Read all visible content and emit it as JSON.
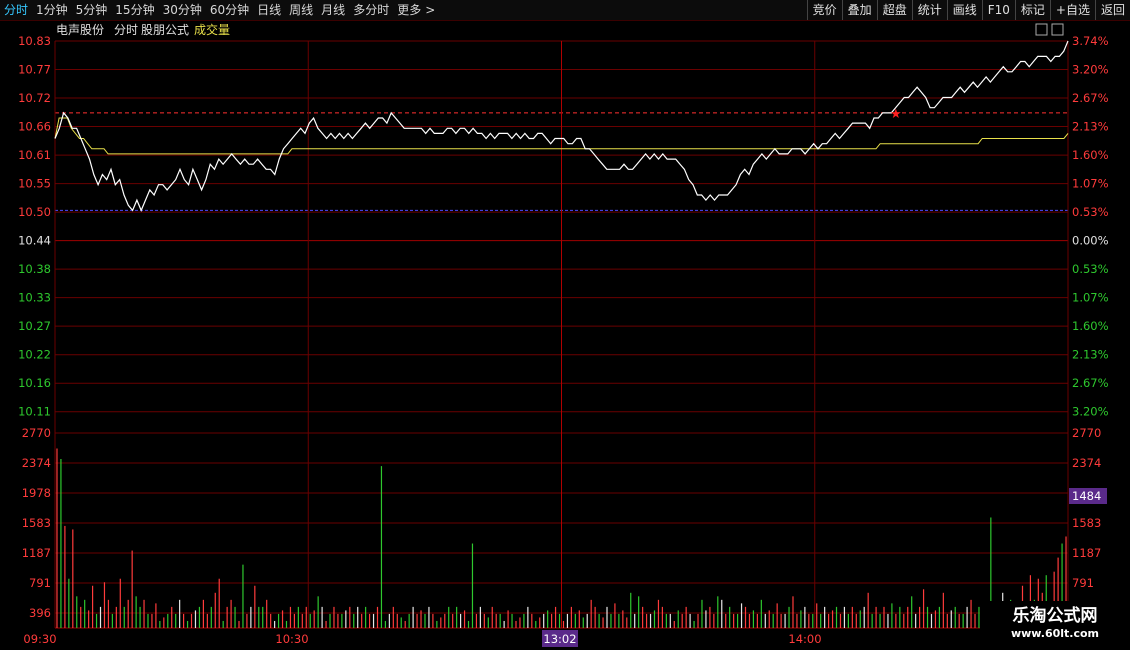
{
  "toolbar": {
    "left_items": [
      {
        "label": "分时",
        "active": true
      },
      {
        "label": "1分钟",
        "active": false
      },
      {
        "label": "5分钟",
        "active": false
      },
      {
        "label": "15分钟",
        "active": false
      },
      {
        "label": "30分钟",
        "active": false
      },
      {
        "label": "60分钟",
        "active": false
      },
      {
        "label": "日线",
        "active": false
      },
      {
        "label": "周线",
        "active": false
      },
      {
        "label": "月线",
        "active": false
      },
      {
        "label": "多分时",
        "active": false
      },
      {
        "label": "更多",
        "active": false
      }
    ],
    "more_icon": "chevron-right-icon",
    "right_items": [
      "竞价",
      "叠加",
      "超盘",
      "统计",
      "画线",
      "F10",
      "标记",
      "+自选",
      "返回"
    ]
  },
  "header": {
    "stock_name": "电声股份",
    "view": "分时",
    "formula": "股朋公式",
    "indicator": "成交量"
  },
  "watermark": {
    "line1": "乐淘公式网",
    "line2": "www.60lt.com"
  },
  "colors": {
    "up": "#ff3b3b",
    "down": "#2ec82e",
    "price": "#ffffff",
    "avg": "#e8e04a",
    "grid": "#6a0000"
  },
  "chart_data": [
    {
      "type": "line",
      "title": "",
      "x_ticks": [
        "09:30",
        "10:30",
        "13:02",
        "14:00"
      ],
      "y_left_ticks": [
        "10.83",
        "10.77",
        "10.72",
        "10.66",
        "10.61",
        "10.55",
        "10.50",
        "10.44",
        "10.38",
        "10.33",
        "10.27",
        "10.22",
        "10.16",
        "10.11"
      ],
      "y_right_ticks": [
        "3.74%",
        "3.20%",
        "2.67%",
        "2.13%",
        "1.60%",
        "1.07%",
        "0.53%",
        "0.00%",
        "0.53%",
        "1.07%",
        "1.60%",
        "2.13%",
        "2.67%",
        "3.20%"
      ],
      "ylim": [
        10.08,
        10.83
      ],
      "prev_close": 10.44,
      "reference_line": 10.5,
      "day_high": 10.69,
      "series": [
        {
          "values": [
            10.64,
            10.66,
            10.69,
            10.68,
            10.66,
            10.66,
            10.64,
            10.62,
            10.6,
            10.57,
            10.55,
            10.57,
            10.56,
            10.58,
            10.55,
            10.56,
            10.53,
            10.51,
            10.5,
            10.52,
            10.5,
            10.52,
            10.54,
            10.53,
            10.55,
            10.55,
            10.54,
            10.55,
            10.56,
            10.58,
            10.56,
            10.55,
            10.58,
            10.56,
            10.54,
            10.56,
            10.59,
            10.58,
            10.6,
            10.59,
            10.6,
            10.61,
            10.6,
            10.59,
            10.6,
            10.59,
            10.59,
            10.6,
            10.59,
            10.58,
            10.58,
            10.57,
            10.6,
            10.62,
            10.63,
            10.64,
            10.65,
            10.66,
            10.65,
            10.67,
            10.68,
            10.66,
            10.65,
            10.64,
            10.65,
            10.64,
            10.65,
            10.64,
            10.65,
            10.64,
            10.65,
            10.66,
            10.67,
            10.66,
            10.67,
            10.68,
            10.68,
            10.67,
            10.69,
            10.68,
            10.67,
            10.66,
            10.66,
            10.66,
            10.66,
            10.66,
            10.65,
            10.66,
            10.65,
            10.65,
            10.65,
            10.66,
            10.66,
            10.65,
            10.66,
            10.66,
            10.65,
            10.66,
            10.65,
            10.65,
            10.64,
            10.65,
            10.64,
            10.65,
            10.65,
            10.65,
            10.64,
            10.65,
            10.64,
            10.65,
            10.64,
            10.64,
            10.65,
            10.65,
            10.64,
            10.63,
            10.64,
            10.64,
            10.64,
            10.63,
            10.63,
            10.64,
            10.64,
            10.62,
            10.62,
            10.61,
            10.6,
            10.59,
            10.58,
            10.58,
            10.58,
            10.58,
            10.59,
            10.58,
            10.58,
            10.59,
            10.6,
            10.61,
            10.6,
            10.61,
            10.6,
            10.61,
            10.6,
            10.6,
            10.6,
            10.59,
            10.58,
            10.56,
            10.55,
            10.53,
            10.53,
            10.52,
            10.53,
            10.52,
            10.53,
            10.53,
            10.53,
            10.54,
            10.55,
            10.57,
            10.58,
            10.57,
            10.59,
            10.6,
            10.61,
            10.6,
            10.61,
            10.62,
            10.61,
            10.61,
            10.61,
            10.62,
            10.62,
            10.62,
            10.61,
            10.62,
            10.63,
            10.62,
            10.63,
            10.63,
            10.64,
            10.65,
            10.64,
            10.65,
            10.66,
            10.67,
            10.67,
            10.67,
            10.67,
            10.66,
            10.68,
            10.68,
            10.69,
            10.69,
            10.69,
            10.7,
            10.71,
            10.72,
            10.72,
            10.73,
            10.74,
            10.73,
            10.72,
            10.7,
            10.7,
            10.71,
            10.72,
            10.72,
            10.72,
            10.73,
            10.74,
            10.73,
            10.74,
            10.75,
            10.74,
            10.75,
            10.76,
            10.75,
            10.76,
            10.77,
            10.78,
            10.77,
            10.77,
            10.78,
            10.79,
            10.79,
            10.78,
            10.79,
            10.8,
            10.8,
            10.8,
            10.79,
            10.8,
            10.8,
            10.81,
            10.83
          ]
        },
        {
          "values": [
            10.64,
            10.68,
            10.68,
            10.68,
            10.66,
            10.65,
            10.64,
            10.64,
            10.63,
            10.62,
            10.62,
            10.62,
            10.62,
            10.61,
            10.61,
            10.61,
            10.61,
            10.61,
            10.61,
            10.61,
            10.61,
            10.61,
            10.61,
            10.61,
            10.61,
            10.61,
            10.61,
            10.61,
            10.61,
            10.61,
            10.61,
            10.61,
            10.61,
            10.61,
            10.61,
            10.61,
            10.61,
            10.61,
            10.61,
            10.61,
            10.61,
            10.61,
            10.61,
            10.61,
            10.61,
            10.61,
            10.61,
            10.61,
            10.61,
            10.61,
            10.61,
            10.61,
            10.61,
            10.61,
            10.61,
            10.61,
            10.61,
            10.61,
            10.62,
            10.62,
            10.62,
            10.62,
            10.62,
            10.62,
            10.62,
            10.62,
            10.62,
            10.62,
            10.62,
            10.62,
            10.62,
            10.62,
            10.62,
            10.62,
            10.62,
            10.62,
            10.62,
            10.62,
            10.62,
            10.62,
            10.62,
            10.62,
            10.62,
            10.62,
            10.62,
            10.62,
            10.62,
            10.62,
            10.62,
            10.62,
            10.62,
            10.62,
            10.62,
            10.62,
            10.62,
            10.62,
            10.62,
            10.62,
            10.62,
            10.62,
            10.62,
            10.62,
            10.62,
            10.62,
            10.62,
            10.62,
            10.62,
            10.62,
            10.62,
            10.62,
            10.62,
            10.62,
            10.62,
            10.62,
            10.62,
            10.62,
            10.62,
            10.62,
            10.62,
            10.62,
            10.62,
            10.62,
            10.62,
            10.62,
            10.62,
            10.62,
            10.62,
            10.62,
            10.62,
            10.62,
            10.62,
            10.62,
            10.62,
            10.62,
            10.62,
            10.62,
            10.62,
            10.62,
            10.62,
            10.62,
            10.62,
            10.62,
            10.62,
            10.62,
            10.62,
            10.62,
            10.62,
            10.62,
            10.62,
            10.62,
            10.62,
            10.62,
            10.62,
            10.62,
            10.62,
            10.62,
            10.62,
            10.62,
            10.62,
            10.62,
            10.62,
            10.62,
            10.62,
            10.62,
            10.62,
            10.62,
            10.62,
            10.62,
            10.62,
            10.62,
            10.62,
            10.62,
            10.62,
            10.62,
            10.62,
            10.62,
            10.62,
            10.62,
            10.62,
            10.62,
            10.62,
            10.62,
            10.62,
            10.62,
            10.62,
            10.62,
            10.62,
            10.62,
            10.62,
            10.62,
            10.62,
            10.62,
            10.62,
            10.62,
            10.62,
            10.62,
            10.62,
            10.62,
            10.62,
            10.62,
            10.62,
            10.62,
            10.63,
            10.63,
            10.63,
            10.63,
            10.63,
            10.63,
            10.63,
            10.63,
            10.63,
            10.63,
            10.63,
            10.63,
            10.63,
            10.63,
            10.63,
            10.63,
            10.63,
            10.63,
            10.63,
            10.63,
            10.63,
            10.63,
            10.63,
            10.63,
            10.63,
            10.64,
            10.64,
            10.64,
            10.64,
            10.64,
            10.64,
            10.64,
            10.64,
            10.64,
            10.64,
            10.64,
            10.64,
            10.64,
            10.64,
            10.64,
            10.64,
            10.64,
            10.64,
            10.64,
            10.64,
            10.64,
            10.65
          ]
        }
      ]
    },
    {
      "type": "bar",
      "title": "",
      "y_ticks": [
        "2770",
        "2374",
        "1978",
        "1583",
        "1187",
        "791",
        "396"
      ],
      "ylim": [
        0,
        2770
      ],
      "last_value_label": "1484",
      "values": [
        2550,
        2400,
        1450,
        700,
        1400,
        450,
        300,
        400,
        250,
        600,
        200,
        300,
        650,
        400,
        200,
        300,
        700,
        300,
        400,
        1100,
        450,
        300,
        400,
        200,
        200,
        350,
        100,
        150,
        200,
        300,
        200,
        400,
        200,
        100,
        200,
        250,
        300,
        400,
        200,
        300,
        500,
        700,
        100,
        300,
        400,
        300,
        100,
        900,
        200,
        300,
        600,
        300,
        300,
        400,
        200,
        100,
        200,
        250,
        100,
        300,
        200,
        300,
        200,
        300,
        200,
        250,
        450,
        300,
        100,
        200,
        300,
        200,
        200,
        250,
        300,
        200,
        300,
        200,
        300,
        200,
        200,
        300,
        2300,
        100,
        200,
        300,
        200,
        150,
        100,
        200,
        300,
        200,
        250,
        200,
        300,
        200,
        100,
        150,
        200,
        300,
        200,
        300,
        200,
        250,
        100,
        1200,
        200,
        300,
        200,
        150,
        300,
        200,
        200,
        100,
        250,
        200,
        100,
        150,
        200,
        300,
        200,
        100,
        150,
        200,
        250,
        200,
        300,
        200,
        100,
        200,
        300,
        200,
        250,
        150,
        200,
        400,
        300,
        200,
        150,
        300,
        200,
        350,
        200,
        250,
        150,
        500,
        200,
        450,
        300,
        200,
        200,
        250,
        400,
        300,
        200,
        200,
        100,
        250,
        200,
        300,
        200,
        100,
        200,
        400,
        250,
        300,
        200,
        450,
        400,
        200,
        300,
        200,
        200,
        350,
        300,
        200,
        250,
        200,
        400,
        200,
        250,
        200,
        350,
        200,
        200,
        300,
        450,
        200,
        250,
        300,
        200,
        200,
        350,
        200,
        300,
        200,
        250,
        300,
        200,
        300,
        200,
        300,
        200,
        250,
        300,
        500,
        200,
        300,
        200,
        300,
        200,
        350,
        200,
        300,
        200,
        300,
        450,
        200,
        300,
        550,
        300,
        200,
        250,
        300,
        500,
        200,
        250,
        300,
        200,
        200,
        300,
        400,
        200,
        300,
        250,
        200,
        1570,
        300,
        200,
        500,
        250,
        400,
        200,
        300,
        600,
        200,
        750,
        400,
        700,
        500,
        750,
        200,
        800,
        1000,
        1200,
        1300
      ],
      "colors_seq": "rgrgrgrgrrgwrrgrrgrrggrgrrgrgrgwrgrwgrrgrrgrrgrgrwrggrrwgrgrrgrrgrgwrgrrgwrgwrgrwrggwrrgrgwrrgwrgrrgrgwrggrwrgrrgwrgrrgwrgrwgrrgrwrgrgwrrgrwgrgrrgwgrrwgrrgwrgrrwgrgwrrgwrgrgwrrgrgwrgrrwgrrgwrgrgwrrgrwgrrgwrgrgrwgrgrrgwrrgwrgrrwgrgwrrgwrgrgw"
    }
  ]
}
